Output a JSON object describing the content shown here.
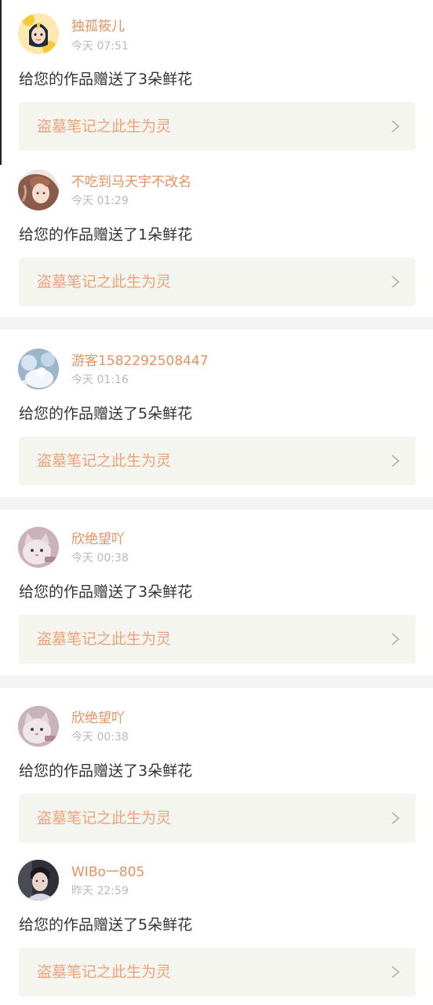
{
  "notifications": [
    {
      "user": "独孤筱儿",
      "time": "今天 07:51",
      "message": "给您的作品赠送了3朵鲜花",
      "work": "盗墓笔记之此生为灵",
      "avatar_icon": "cartoon-girl-avatar"
    },
    {
      "user": "不吃到马天宇不改名",
      "time": "今天 01:29",
      "message": "给您的作品赠送了1朵鲜花",
      "work": "盗墓笔记之此生为灵",
      "avatar_icon": "anime-portrait-avatar"
    },
    {
      "user": "游客1582292508447",
      "time": "今天 01:16",
      "message": "给您的作品赠送了5朵鲜花",
      "work": "盗墓笔记之此生为灵",
      "avatar_icon": "snow-scene-avatar"
    },
    {
      "user": "欣绝望吖",
      "time": "今天 00:38",
      "message": "给您的作品赠送了3朵鲜花",
      "work": "盗墓笔记之此生为灵",
      "avatar_icon": "cat-photo-avatar"
    },
    {
      "user": "欣绝望吖",
      "time": "今天 00:38",
      "message": "给您的作品赠送了3朵鲜花",
      "work": "盗墓笔记之此生为灵",
      "avatar_icon": "cat-photo-avatar"
    },
    {
      "user": "WIBo一805",
      "time": "昨天 22:59",
      "message": "给您的作品赠送了5朵鲜花",
      "work": "盗墓笔记之此生为灵",
      "avatar_icon": "person-photo-avatar"
    }
  ],
  "colors": {
    "username": "#e8915e",
    "timestamp": "#b8b8b8",
    "message": "#333333",
    "card_bg": "#f5f5ef",
    "card_title": "#eda27a",
    "separator": "#f4f4f4"
  },
  "icons": {
    "card_arrow": "chevron-right-icon"
  }
}
